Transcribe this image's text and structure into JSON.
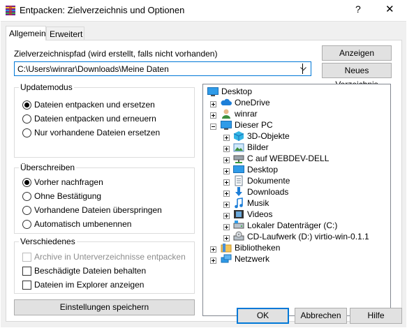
{
  "window": {
    "title": "Entpacken: Zielverzeichnis und Optionen",
    "help": "?",
    "close": "✕"
  },
  "tabs": [
    {
      "label": "Allgemein",
      "active": true
    },
    {
      "label": "Erweitert",
      "active": false
    }
  ],
  "dest": {
    "label": "Zielverzeichnispfad (wird erstellt, falls nicht vorhanden)",
    "value": "C:\\Users\\winrar\\Downloads\\Meine Daten",
    "show_button": "Anzeigen",
    "new_folder_button": "Neues Verzeichnis"
  },
  "update_mode": {
    "title": "Updatemodus",
    "options": [
      {
        "label": "Dateien entpacken und ersetzen",
        "checked": true
      },
      {
        "label": "Dateien entpacken und erneuern",
        "checked": false
      },
      {
        "label": "Nur vorhandene Dateien ersetzen",
        "checked": false
      }
    ]
  },
  "overwrite": {
    "title": "Überschreiben",
    "options": [
      {
        "label": "Vorher nachfragen",
        "checked": true
      },
      {
        "label": "Ohne Bestätigung",
        "checked": false
      },
      {
        "label": "Vorhandene Dateien überspringen",
        "checked": false
      },
      {
        "label": "Automatisch umbenennen",
        "checked": false
      }
    ]
  },
  "misc": {
    "title": "Verschiedenes",
    "options": [
      {
        "label": "Archive in Unterverzeichnisse entpacken",
        "checked": false,
        "disabled": true
      },
      {
        "label": "Beschädigte Dateien behalten",
        "checked": false,
        "disabled": false
      },
      {
        "label": "Dateien im Explorer anzeigen",
        "checked": false,
        "disabled": false
      }
    ]
  },
  "save_settings_button": "Einstellungen speichern",
  "tree": [
    {
      "label": "Desktop",
      "icon": "desktop-icon",
      "expander": "none"
    },
    {
      "label": "OneDrive",
      "icon": "cloud-icon",
      "expander": "plus"
    },
    {
      "label": "winrar",
      "icon": "user-icon",
      "expander": "plus"
    },
    {
      "label": "Dieser PC",
      "icon": "computer-icon",
      "expander": "minus"
    },
    {
      "label": "3D-Objekte",
      "icon": "cube-icon",
      "expander": "plus"
    },
    {
      "label": "Bilder",
      "icon": "pictures-icon",
      "expander": "plus"
    },
    {
      "label": "C auf WEBDEV-DELL",
      "icon": "network-drive-icon",
      "expander": "plus"
    },
    {
      "label": "Desktop",
      "icon": "desktop-icon",
      "expander": "plus"
    },
    {
      "label": "Dokumente",
      "icon": "documents-icon",
      "expander": "plus"
    },
    {
      "label": "Downloads",
      "icon": "download-icon",
      "expander": "plus"
    },
    {
      "label": "Musik",
      "icon": "music-icon",
      "expander": "plus"
    },
    {
      "label": "Videos",
      "icon": "film-icon",
      "expander": "plus"
    },
    {
      "label": "Lokaler Datenträger (C:)",
      "icon": "hard-drive-icon",
      "expander": "plus"
    },
    {
      "label": "CD-Laufwerk (D:) virtio-win-0.1.1",
      "icon": "cd-drive-icon",
      "expander": "plus"
    },
    {
      "label": "Bibliotheken",
      "icon": "library-icon",
      "expander": "plus"
    },
    {
      "label": "Netzwerk",
      "icon": "network-icon",
      "expander": "plus"
    }
  ],
  "footer": {
    "ok": "OK",
    "cancel": "Abbrechen",
    "help": "Hilfe"
  },
  "colors": {
    "accent": "#0078d7",
    "dialog_bg": "#f0f0f0",
    "button_bg": "#e1e1e1"
  }
}
